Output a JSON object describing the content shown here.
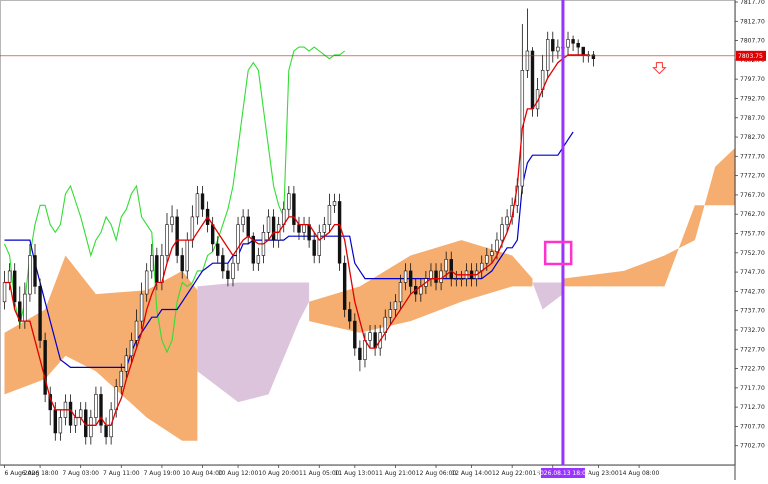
{
  "colors": {
    "cloud_bull": "#f4a460",
    "cloud_bear": "#d8bfd8",
    "tenkan": "#e00000",
    "kijun": "#0000cc",
    "chikou": "#33dd33",
    "senkou_a_line": "#ff69b4",
    "senkou_b_line": "#2f4f4f",
    "candle": "#111111",
    "current_price_line": "#cc2222",
    "vertical_marker": "#9933ff",
    "highlight_box": "#ff33cc",
    "price_tag_bg": "#e00000",
    "arrow": "#ff3333"
  },
  "current_price_label": "7803.75",
  "marker_time_label": "2026.08.13 18:00",
  "arrow_icon": "down-arrow-icon",
  "chart_data": {
    "type": "candlestick",
    "title": "",
    "xlabel": "",
    "ylabel": "",
    "ylim": [
      7697.7,
      7817.7
    ],
    "grid": false,
    "current_price": 7803.75,
    "marker_x_index": 110,
    "yticks": [
      "7817.70",
      "7812.70",
      "7807.70",
      "7802.70",
      "7797.70",
      "7792.70",
      "7787.70",
      "7782.70",
      "7777.70",
      "7772.70",
      "7767.70",
      "7762.70",
      "7757.70",
      "7752.70",
      "7747.70",
      "7742.70",
      "7737.70",
      "7732.70",
      "7727.70",
      "7722.70",
      "7717.70",
      "7712.70",
      "7707.70",
      "7702.70"
    ],
    "xticks": [
      {
        "i": 0,
        "label": "6 Aug 2026"
      },
      {
        "i": 7,
        "label": "6 Aug 18:00"
      },
      {
        "i": 15,
        "label": "7 Aug 03:00"
      },
      {
        "i": 23,
        "label": "7 Aug 11:00"
      },
      {
        "i": 31,
        "label": "7 Aug 19:00"
      },
      {
        "i": 39,
        "label": "10 Aug 04:00"
      },
      {
        "i": 46,
        "label": "10 Aug 12:00"
      },
      {
        "i": 54,
        "label": "10 Aug 20:00"
      },
      {
        "i": 62,
        "label": "11 Aug 05:00"
      },
      {
        "i": 69,
        "label": "11 Aug 13:00"
      },
      {
        "i": 77,
        "label": "11 Aug 21:00"
      },
      {
        "i": 85,
        "label": "12 Aug 06:00"
      },
      {
        "i": 92,
        "label": "12 Aug 14:00"
      },
      {
        "i": 100,
        "label": "12 Aug 22:00"
      },
      {
        "i": 108,
        "label": "13 Aug 07:00"
      },
      {
        "i": 117,
        "label": "13 Aug 23:00"
      },
      {
        "i": 125,
        "label": "14 Aug 08:00"
      }
    ],
    "candles_close": [
      7745,
      7748,
      7740,
      7735,
      7742,
      7752,
      7744,
      7730,
      7716,
      7712,
      7706,
      7710,
      7714,
      7708,
      7710,
      7712,
      7705,
      7710,
      7716,
      7708,
      7705,
      7712,
      7718,
      7722,
      7726,
      7730,
      7735,
      7742,
      7748,
      7752,
      7745,
      7752,
      7760,
      7762,
      7752,
      7748,
      7756,
      7762,
      7768,
      7764,
      7760,
      7755,
      7752,
      7748,
      7746,
      7750,
      7760,
      7762,
      7757,
      7750,
      7752,
      7758,
      7762,
      7756,
      7760,
      7764,
      7768,
      7760,
      7758,
      7760,
      7756,
      7752,
      7758,
      7760,
      7765,
      7766,
      7750,
      7738,
      7735,
      7728,
      7725,
      7730,
      7732,
      7728,
      7732,
      7736,
      7738,
      7740,
      7745,
      7748,
      7744,
      7742,
      7744,
      7746,
      7748,
      7745,
      7748,
      7751,
      7746,
      7746,
      7746,
      7748,
      7746,
      7748,
      7750,
      7752,
      7753,
      7756,
      7760,
      7762,
      7765,
      7770,
      7800,
      7805,
      7790,
      7795,
      7800,
      7808,
      7805,
      7806,
      7806,
      7808,
      7807,
      7806,
      7804,
      7804,
      7803
    ],
    "candles_open": [
      7740,
      7745,
      7748,
      7740,
      7735,
      7742,
      7752,
      7744,
      7730,
      7716,
      7712,
      7706,
      7710,
      7714,
      7708,
      7710,
      7712,
      7705,
      7710,
      7716,
      7708,
      7705,
      7712,
      7718,
      7722,
      7726,
      7730,
      7735,
      7742,
      7748,
      7752,
      7745,
      7752,
      7760,
      7762,
      7752,
      7748,
      7756,
      7762,
      7768,
      7764,
      7760,
      7755,
      7752,
      7748,
      7746,
      7750,
      7760,
      7762,
      7757,
      7750,
      7752,
      7758,
      7762,
      7756,
      7760,
      7764,
      7768,
      7760,
      7758,
      7760,
      7756,
      7752,
      7758,
      7760,
      7765,
      7766,
      7750,
      7738,
      7735,
      7728,
      7725,
      7730,
      7732,
      7728,
      7732,
      7736,
      7738,
      7740,
      7745,
      7748,
      7744,
      7742,
      7744,
      7746,
      7748,
      7745,
      7748,
      7751,
      7746,
      7746,
      7746,
      7748,
      7746,
      7748,
      7750,
      7752,
      7753,
      7756,
      7760,
      7762,
      7765,
      7770,
      7800,
      7805,
      7790,
      7795,
      7800,
      7808,
      7805,
      7806,
      7806,
      7808,
      7807,
      7806,
      7804,
      7804
    ],
    "candles_high": [
      7748,
      7750,
      7750,
      7744,
      7745,
      7755,
      7755,
      7746,
      7732,
      7718,
      7714,
      7712,
      7716,
      7716,
      7712,
      7714,
      7714,
      7712,
      7718,
      7718,
      7710,
      7714,
      7720,
      7724,
      7728,
      7732,
      7738,
      7745,
      7750,
      7755,
      7754,
      7755,
      7763,
      7765,
      7764,
      7754,
      7758,
      7765,
      7770,
      7770,
      7766,
      7762,
      7757,
      7754,
      7750,
      7752,
      7762,
      7764,
      7764,
      7758,
      7754,
      7760,
      7764,
      7764,
      7762,
      7766,
      7770,
      7770,
      7762,
      7762,
      7762,
      7758,
      7760,
      7762,
      7768,
      7768,
      7768,
      7752,
      7740,
      7737,
      7730,
      7732,
      7734,
      7734,
      7734,
      7738,
      7740,
      7742,
      7747,
      7750,
      7750,
      7746,
      7746,
      7748,
      7750,
      7750,
      7750,
      7753,
      7753,
      7748,
      7748,
      7750,
      7750,
      7750,
      7752,
      7754,
      7755,
      7758,
      7762,
      7764,
      7767,
      7772,
      7812,
      7816,
      7806,
      7798,
      7804,
      7810,
      7810,
      7808,
      7808,
      7810,
      7809,
      7808,
      7806,
      7805,
      7805
    ],
    "candles_low": [
      7738,
      7743,
      7738,
      7733,
      7733,
      7740,
      7742,
      7728,
      7714,
      7708,
      7704,
      7704,
      7708,
      7706,
      7706,
      7708,
      7703,
      7703,
      7708,
      7706,
      7703,
      7703,
      7710,
      7716,
      7720,
      7724,
      7728,
      7733,
      7740,
      7746,
      7743,
      7743,
      7750,
      7758,
      7750,
      7746,
      7746,
      7754,
      7760,
      7762,
      7758,
      7753,
      7750,
      7746,
      7744,
      7744,
      7748,
      7758,
      7755,
      7748,
      7748,
      7750,
      7756,
      7754,
      7754,
      7758,
      7762,
      7758,
      7756,
      7756,
      7754,
      7750,
      7750,
      7756,
      7758,
      7763,
      7748,
      7736,
      7733,
      7726,
      7722,
      7723,
      7728,
      7726,
      7726,
      7730,
      7734,
      7736,
      7738,
      7743,
      7742,
      7740,
      7740,
      7742,
      7744,
      7743,
      7743,
      7746,
      7744,
      7744,
      7744,
      7744,
      7744,
      7744,
      7746,
      7748,
      7750,
      7751,
      7754,
      7758,
      7760,
      7763,
      7768,
      7798,
      7788,
      7788,
      7793,
      7798,
      7802,
      7803,
      7804,
      7804,
      7805,
      7804,
      7802,
      7802,
      7801
    ],
    "tenkan": [
      7745,
      7745,
      7738,
      7735,
      7735,
      7735,
      7730,
      7725,
      7720,
      7715,
      7712,
      7712,
      7712,
      7712,
      7710,
      7710,
      7708,
      7708,
      7708,
      7710,
      7708,
      7708,
      7712,
      7715,
      7720,
      7724,
      7728,
      7732,
      7738,
      7742,
      7745,
      7745,
      7750,
      7754,
      7756,
      7756,
      7756,
      7756,
      7758,
      7760,
      7762,
      7760,
      7758,
      7756,
      7754,
      7752,
      7754,
      7756,
      7757,
      7756,
      7755,
      7755,
      7756,
      7758,
      7758,
      7760,
      7762,
      7762,
      7760,
      7760,
      7760,
      7758,
      7756,
      7757,
      7758,
      7760,
      7760,
      7756,
      7748,
      7740,
      7735,
      7730,
      7728,
      7728,
      7730,
      7732,
      7734,
      7736,
      7738,
      7740,
      7742,
      7743,
      7744,
      7745,
      7746,
      7746,
      7746,
      7747,
      7748,
      7747,
      7747,
      7747,
      7747,
      7747,
      7748,
      7749,
      7750,
      7752,
      7755,
      7758,
      7762,
      7770,
      7785,
      7790,
      7790,
      7792,
      7795,
      7798,
      7800,
      7802,
      7803,
      7804,
      7804,
      7804,
      7804,
      7804
    ],
    "kijun": [
      7756,
      7756,
      7756,
      7756,
      7756,
      7756,
      7750,
      7745,
      7740,
      7735,
      7730,
      7725,
      7724,
      7723,
      7723,
      7723,
      7723,
      7723,
      7723,
      7723,
      7723,
      7723,
      7723,
      7723,
      7723,
      7727,
      7730,
      7732,
      7734,
      7736,
      7736,
      7738,
      7738,
      7738,
      7738,
      7740,
      7742,
      7744,
      7746,
      7748,
      7749,
      7750,
      7750,
      7750,
      7750,
      7752,
      7752,
      7755,
      7755,
      7756,
      7756,
      7756,
      7756,
      7756,
      7756,
      7756,
      7757,
      7757,
      7757,
      7757,
      7757,
      7757,
      7757,
      7757,
      7757,
      7757,
      7757,
      7757,
      7757,
      7750,
      7748,
      7746,
      7746,
      7746,
      7746,
      7746,
      7746,
      7746,
      7746,
      7746,
      7746,
      7746,
      7746,
      7746,
      7746,
      7746,
      7746,
      7746,
      7746,
      7746,
      7746,
      7746,
      7746,
      7746,
      7746,
      7747,
      7748,
      7750,
      7752,
      7754,
      7754,
      7756,
      7770,
      7776,
      7778,
      7778,
      7778,
      7778,
      7778,
      7778,
      7780,
      7782,
      7784
    ],
    "chikou": [
      7755,
      7752,
      7740,
      7734,
      7740,
      7752,
      7760,
      7765,
      7765,
      7760,
      7758,
      7760,
      7768,
      7770,
      7766,
      7762,
      7757,
      7752,
      7756,
      7758,
      7762,
      7760,
      7756,
      7762,
      7764,
      7768,
      7770,
      7762,
      7760,
      7758,
      7738,
      7730,
      7727,
      7730,
      7740,
      7745,
      7744,
      7745,
      7748,
      7748,
      7752,
      7753,
      7756,
      7760,
      7764,
      7770,
      7780,
      7790,
      7800,
      7802,
      7800,
      7790,
      7780,
      7770,
      7765,
      7762,
      7800,
      7805,
      7806,
      7806,
      7805,
      7806,
      7805,
      7804,
      7803,
      7804,
      7804,
      7805
    ],
    "chikou_start": 0,
    "cloud_bull_upper": [
      [
        0,
        7732
      ],
      [
        8,
        7738
      ],
      [
        12,
        7752
      ],
      [
        18,
        7742
      ],
      [
        28,
        7743
      ],
      [
        35,
        7748
      ],
      [
        38,
        7743
      ]
    ],
    "cloud_bull_lower": [
      [
        0,
        7716
      ],
      [
        8,
        7720
      ],
      [
        12,
        7726
      ],
      [
        18,
        7722
      ],
      [
        28,
        7710
      ],
      [
        35,
        7704
      ],
      [
        38,
        7704
      ]
    ],
    "cloud_bear_top": [
      [
        38,
        7744
      ],
      [
        46,
        7745
      ],
      [
        58,
        7745
      ],
      [
        60,
        7745
      ]
    ],
    "cloud_bear_bottom": [
      [
        38,
        7722
      ],
      [
        46,
        7714
      ],
      [
        52,
        7716
      ],
      [
        58,
        7735
      ],
      [
        60,
        7740
      ]
    ],
    "cloud2_bull_upper": [
      [
        60,
        7740
      ],
      [
        70,
        7744
      ],
      [
        80,
        7752
      ],
      [
        90,
        7756
      ],
      [
        100,
        7752
      ],
      [
        104,
        7746
      ]
    ],
    "cloud2_bull_lower": [
      [
        60,
        7735
      ],
      [
        70,
        7732
      ],
      [
        80,
        7735
      ],
      [
        90,
        7740
      ],
      [
        100,
        7744
      ],
      [
        104,
        7744
      ]
    ],
    "cloud2_bear_top": [
      [
        104,
        7745
      ],
      [
        110,
        7745
      ]
    ],
    "cloud2_bear_bottom": [
      [
        104,
        7745
      ],
      [
        106,
        7738
      ],
      [
        110,
        7742
      ]
    ],
    "cloud3_bull_upper": [
      [
        110,
        7746
      ],
      [
        122,
        7748
      ],
      [
        130,
        7752
      ],
      [
        136,
        7756
      ],
      [
        140,
        7775
      ],
      [
        144,
        7780
      ]
    ],
    "cloud3_bull_lower": [
      [
        110,
        7744
      ],
      [
        122,
        7744
      ],
      [
        130,
        7744
      ],
      [
        136,
        7765
      ],
      [
        140,
        7765
      ],
      [
        144,
        7765
      ]
    ]
  }
}
